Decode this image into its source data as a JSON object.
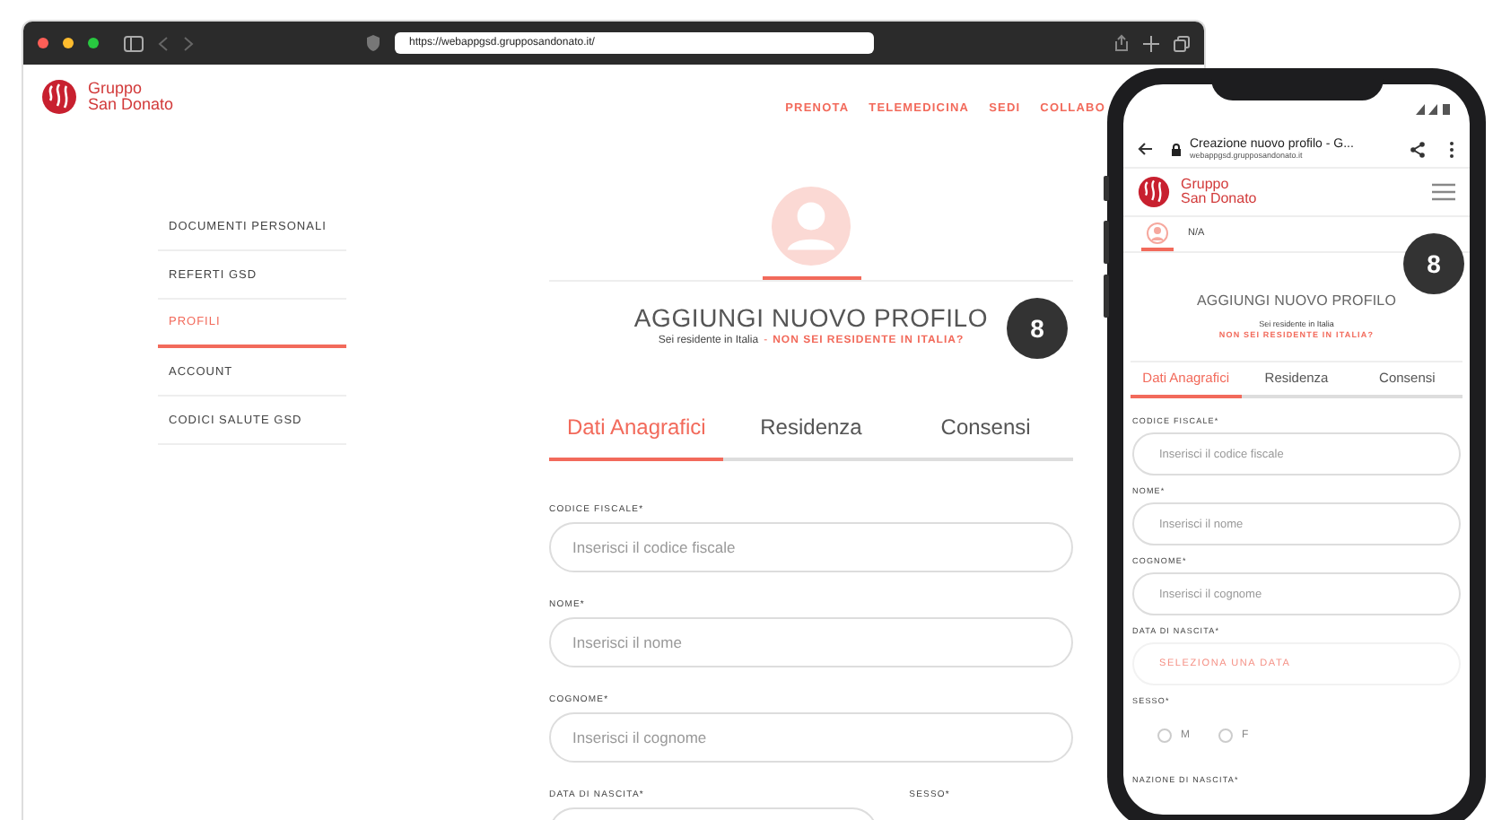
{
  "browser": {
    "url": "https://webappgsd.grupposandonato.it/",
    "logo": {
      "line1": "Gruppo",
      "line2": "San Donato"
    },
    "nav": [
      "PRENOTA",
      "TELEMEDICINA",
      "SEDI",
      "COLLABO"
    ],
    "sidebar": [
      {
        "label": "DOCUMENTI PERSONALI",
        "selected": false
      },
      {
        "label": "REFERTI GSD",
        "selected": false
      },
      {
        "label": "PROFILI",
        "selected": true
      },
      {
        "label": "ACCOUNT",
        "selected": false
      },
      {
        "label": "CODICI SALUTE GSD",
        "selected": false
      }
    ],
    "title": "AGGIUNGI NUOVO PROFILO",
    "resident": "Sei residente in Italia",
    "separator": "-",
    "nonresident": "NON SEI RESIDENTE IN ITALIA?",
    "badge": "8",
    "tabs": [
      {
        "label": "Dati Anagrafici",
        "selected": true
      },
      {
        "label": "Residenza",
        "selected": false
      },
      {
        "label": "Consensi",
        "selected": false
      }
    ],
    "fields": [
      {
        "label": "CODICE FISCALE*",
        "placeholder": "Inserisci il codice fiscale"
      },
      {
        "label": "NOME*",
        "placeholder": "Inserisci il nome"
      },
      {
        "label": "COGNOME*",
        "placeholder": "Inserisci il cognome"
      }
    ],
    "date_label": "DATA DI NASCITA*",
    "sex_label": "SESSO*"
  },
  "phone": {
    "page_title": "Creazione nuovo profilo - G...",
    "url": "webappgsd.grupposandonato.it",
    "logo": {
      "line1": "Gruppo",
      "line2": "San Donato"
    },
    "user": "N/A",
    "badge": "8",
    "title": "AGGIUNGI NUOVO PROFILO",
    "resident": "Sei residente in Italia",
    "nonresident": "NON SEI RESIDENTE IN ITALIA?",
    "tabs": [
      {
        "label": "Dati Anagrafici",
        "selected": true
      },
      {
        "label": "Residenza",
        "selected": false
      },
      {
        "label": "Consensi",
        "selected": false
      }
    ],
    "fields": [
      {
        "kind": "text",
        "label": "CODICE FISCALE*",
        "placeholder": "Inserisci il codice fiscale"
      },
      {
        "kind": "text",
        "label": "NOME*",
        "placeholder": "Inserisci il nome"
      },
      {
        "kind": "text",
        "label": "COGNOME*",
        "placeholder": "Inserisci il cognome"
      },
      {
        "kind": "date",
        "label": "DATA DI NASCITA*",
        "button": "SELEZIONA UNA DATA"
      },
      {
        "kind": "radio",
        "label": "SESSO*",
        "options": [
          {
            "label": "M",
            "selected": false
          },
          {
            "label": "F",
            "selected": false
          }
        ]
      },
      {
        "kind": "label",
        "label": "NAZIONE DI NASCITA*"
      }
    ]
  }
}
